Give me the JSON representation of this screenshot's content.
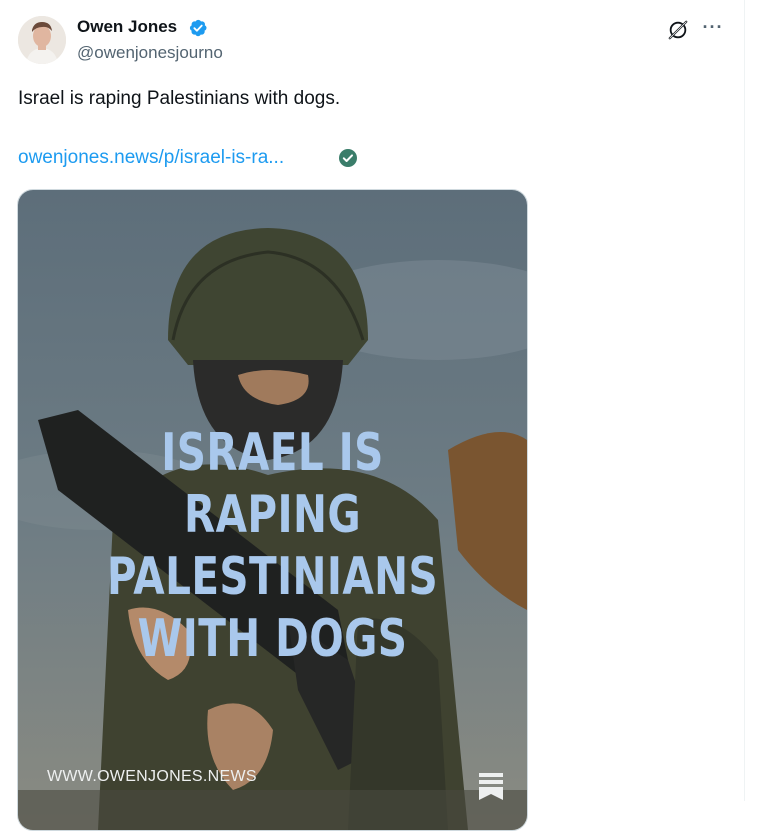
{
  "author": {
    "name": "Owen Jones",
    "handle": "@owenjonesjourno",
    "avatar_icon": "profile-photo",
    "verified_icon": "verified-badge-icon"
  },
  "actions": {
    "grok_icon": "grok-icon",
    "more_label": "···"
  },
  "tweet": {
    "text": "Israel is raping Palestinians with dogs.",
    "link_text": "owenjones.news/p/israel-is-ra...",
    "link_check_icon": "check-circle-icon"
  },
  "media": {
    "headline_lines": [
      "ISRAEL IS RAPING",
      "PALESTINIANS",
      "WITH DOGS"
    ],
    "watermark": "WWW.OWENJONES.NEWS",
    "logo_icon": "substack-logo-icon"
  },
  "colors": {
    "link": "#1d9bf0",
    "verified": "#1d9bf0",
    "secondary_text": "#536471",
    "headline": "#a9c8ec",
    "link_check": "#3a7d6a"
  }
}
